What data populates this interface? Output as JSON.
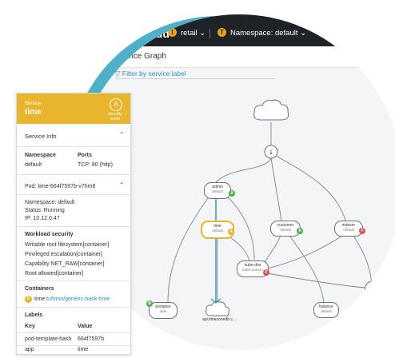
{
  "app": {
    "brand": "ecureCloud",
    "org_label": "retail",
    "namespace_label": "Namespace: default",
    "org_icon_letter": "l",
    "ns_icon_letter": "T"
  },
  "page": {
    "title": "Service Graph",
    "filter_label": "Filter by service label"
  },
  "graph": {
    "nodes": [
      {
        "id": "admin",
        "name": "admin",
        "ns": "default",
        "badge": "A",
        "badge_color": "#4caf50"
      },
      {
        "id": "time",
        "name": "time",
        "ns": "default",
        "badge": "A",
        "badge_color": "#e9b52c",
        "selected": true
      },
      {
        "id": "customer",
        "name": "customer",
        "ns": "default",
        "badge": "A",
        "badge_color": "#4caf50"
      },
      {
        "id": "indexer",
        "name": "indexer",
        "ns": "default",
        "badge": "F",
        "badge_color": "#d9534f"
      },
      {
        "id": "kubedns",
        "name": "kube-dns",
        "ns": "kube-system",
        "badge": "F",
        "badge_color": "#d9534f"
      },
      {
        "id": "postgres",
        "name": "postgres",
        "ns": "data",
        "badge": "B",
        "badge_color": "#4caf50"
      },
      {
        "id": "balance",
        "name": "balance",
        "ns": "default"
      },
      {
        "id": "fw",
        "name": "fw",
        "ns": "de"
      }
    ],
    "external_label": "api.timezonedb.c...",
    "badge_colors": {
      "good": "#4caf50",
      "warn": "#e9b52c",
      "bad": "#d9534f"
    }
  },
  "panel": {
    "header_small": "Service",
    "header_name": "time",
    "security_label_1": "security",
    "security_label_2": "score",
    "security_icon": "A",
    "service_info_title": "Service Info",
    "namespace_key": "Namespace",
    "namespace_val": "default",
    "ports_key": "Ports",
    "ports_val": "TCP: 80 (http)",
    "pod_title": "Pod: time-664f7597b-v7hm8",
    "pod_namespace": "Namespace: default",
    "pod_status": "Status: Running",
    "pod_ip": "IP: 10.12.0.47",
    "workload_title": "Workload security",
    "workload_items": [
      "Writable root filesystem[container]",
      "Privileged escalation[container]",
      "Capability NET_RAW[container]",
      "Root allowed[container]"
    ],
    "containers_title": "Containers",
    "container_prefix": "time:",
    "container_link": "tufinnn/generic-bank-time",
    "container_badge": "B",
    "labels_title": "Labels",
    "labels_key_head": "Key",
    "labels_val_head": "Value",
    "labels": [
      {
        "key": "pod-template-hash",
        "value": "664f7597b"
      },
      {
        "key": "app",
        "value": "time"
      }
    ]
  },
  "colors": {
    "accent": "#e9b52c",
    "topbar": "#1f2226",
    "link": "#2b8fbf",
    "teal": "#4fb1c9"
  }
}
